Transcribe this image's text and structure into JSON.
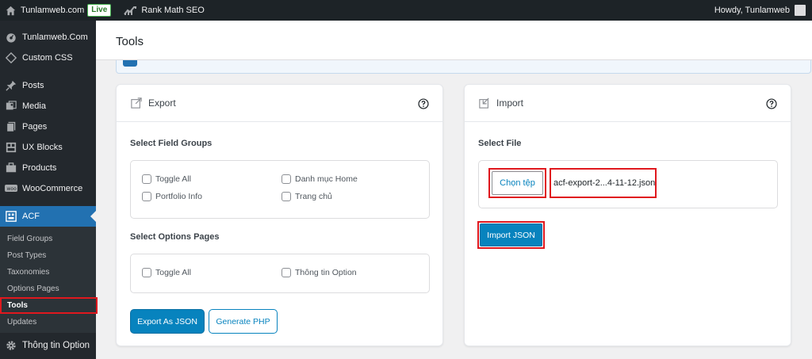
{
  "adminbar": {
    "site_name": "Tunlamweb.com",
    "live_badge": "Live",
    "rank_math": "Rank Math SEO",
    "howdy": "Howdy, Tunlamweb"
  },
  "sidebar": {
    "top_items": [
      {
        "label": "Tunlamweb.Com",
        "icon": "dashboard-icon"
      },
      {
        "label": "Custom CSS",
        "icon": "css-icon"
      }
    ],
    "items": [
      {
        "label": "Posts",
        "icon": "pin-icon"
      },
      {
        "label": "Media",
        "icon": "media-icon"
      },
      {
        "label": "Pages",
        "icon": "pages-icon"
      },
      {
        "label": "UX Blocks",
        "icon": "blocks-icon"
      },
      {
        "label": "Products",
        "icon": "products-icon"
      },
      {
        "label": "WooCommerce",
        "icon": "woo-icon"
      }
    ],
    "acf": {
      "label": "ACF",
      "icon": "acf-icon"
    },
    "submenu": [
      "Field Groups",
      "Post Types",
      "Taxonomies",
      "Options Pages",
      "Tools",
      "Updates"
    ],
    "bottom": {
      "label": "Thông tin Option",
      "icon": "gear-icon"
    }
  },
  "page": {
    "title": "Tools"
  },
  "export": {
    "title": "Export",
    "field_groups_label": "Select Field Groups",
    "field_groups": [
      "Toggle All",
      "Danh mục Home",
      "Portfolio Info",
      "Trang chủ"
    ],
    "options_label": "Select Options Pages",
    "options": [
      "Toggle All",
      "Thông tin Option"
    ],
    "export_json": "Export As JSON",
    "generate_php": "Generate PHP"
  },
  "import": {
    "title": "Import",
    "select_file_label": "Select File",
    "choose_file": "Chọn tệp",
    "file_name": "acf-export-2...4-11-12.json",
    "import_json": "Import JSON"
  },
  "colors": {
    "accent": "#0783be",
    "highlight": "#e0181e",
    "sidebar": "#23282d",
    "active": "#2271b1"
  }
}
